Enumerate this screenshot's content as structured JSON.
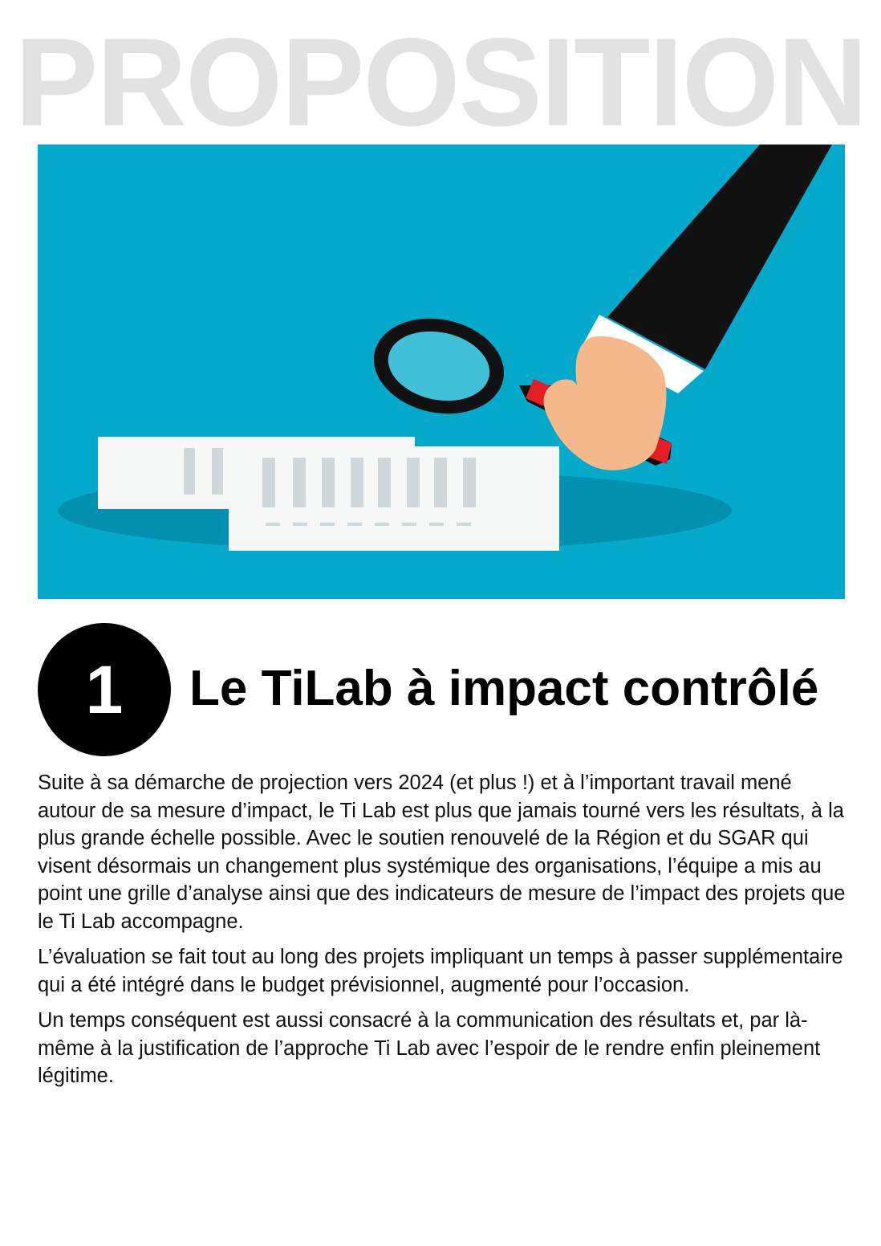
{
  "header": {
    "banner_text": "PROPOSITION"
  },
  "illustration": {
    "description_icon": "magnifying-glass-over-documents-icon",
    "colors": {
      "background": "#02a9cb",
      "shadow": "#0190b0",
      "sleeve": "#111111",
      "cuff": "#ffffff",
      "skin": "#f7b98b",
      "handle_tip": "#e31d24",
      "lens": "#3fc0d8",
      "paper": "#f6f8f8",
      "paper_marks": "#cfd8db"
    }
  },
  "section": {
    "number": "1",
    "title": "Le TiLab à impact contrôlé"
  },
  "paragraphs": [
    "Suite à sa démarche de projection vers 2024 (et plus !) et à l’important travail mené autour de sa mesure d’impact, le Ti Lab est plus que jamais tourné vers les résultats, à la plus grande échelle possible. Avec le soutien renouvelé de la Région et du SGAR qui visent désormais un changement plus systémique des organisations, l’équipe a mis au point une grille d’analyse ainsi que des indicateurs de mesure de l’impact des projets que le Ti Lab accompagne.",
    "L’évaluation se fait tout au long des projets impliquant un temps à passer supplémentaire qui a été intégré dans le budget prévisionnel, augmenté pour l’occasion.",
    "Un temps conséquent est aussi consacré à la communication des résultats et, par là-même à la justification de l’approche Ti Lab avec l’espoir de le rendre enfin pleinement légitime."
  ]
}
